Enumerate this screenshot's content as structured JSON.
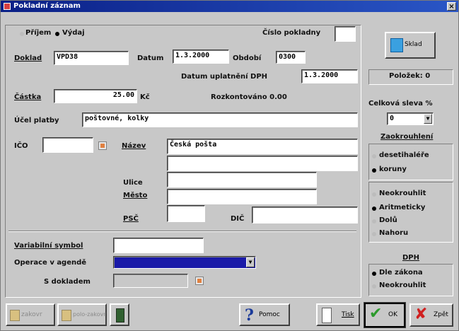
{
  "window": {
    "title": "Pokladní záznam",
    "close": "×"
  },
  "direction": {
    "prijem": "Příjem",
    "vydej": "Výdaj",
    "selected": "vydej"
  },
  "cislo_pokladny": {
    "label": "Číslo pokladny",
    "value": ""
  },
  "doklad": {
    "label": "Doklad",
    "value": "VPD38"
  },
  "datum": {
    "label": "Datum",
    "value": "1.3.2000"
  },
  "obdobi": {
    "label": "Období",
    "value": "0300"
  },
  "datum_dph": {
    "label": "Datum uplatnění DPH",
    "value": "1.3.2000"
  },
  "castka": {
    "label": "Částka",
    "value": "25.00",
    "currency": "Kč"
  },
  "rozkontovano": "Rozkontováno 0.00",
  "ucel": {
    "label": "Účel platby",
    "value": "poštovné, kolky"
  },
  "ico": {
    "label": "IČO",
    "value": ""
  },
  "nazev": {
    "label": "Název",
    "line1": "Česká pošta",
    "line2": ""
  },
  "ulice": {
    "label": "Ulice",
    "value": ""
  },
  "mesto": {
    "label": "Město",
    "value": ""
  },
  "psc": {
    "label": "PSČ",
    "value": ""
  },
  "dic": {
    "label": "DIČ",
    "value": ""
  },
  "variabilni": {
    "label": "Variabilní symbol",
    "value": ""
  },
  "operace": {
    "label": "Operace v agendě",
    "value": ""
  },
  "s_dokladem": {
    "label": "S dokladem",
    "value": ""
  },
  "right": {
    "sklad": "Sklad",
    "polozek": "Položek: 0",
    "sleva_label": "Celková sleva %",
    "sleva_value": "0",
    "zaokrouhleni_label": "Zaokrouhlení",
    "z1": [
      "desetihaléře",
      "koruny"
    ],
    "z1_selected": 1,
    "z2": [
      "Neokrouhlit",
      "Aritmeticky",
      "Dolů",
      "Nahoru"
    ],
    "z2_selected": 1,
    "dph_label": "DPH",
    "dph": [
      "Dle zákona",
      "Neokrouhlit"
    ],
    "dph_selected": 0
  },
  "bottom": {
    "zakovr": "zakovr",
    "polozakovr": "polo-zakovr",
    "pomoc": "Pomoc",
    "tisk": "Tisk",
    "ok": "OK",
    "zpet": "Zpět"
  },
  "colors": {
    "title_bar": "#0a1f86",
    "face": "#c8c8c8",
    "selection": "#1a1aa8",
    "ok_check": "#2c9a2c",
    "cancel_x": "#d02020"
  }
}
